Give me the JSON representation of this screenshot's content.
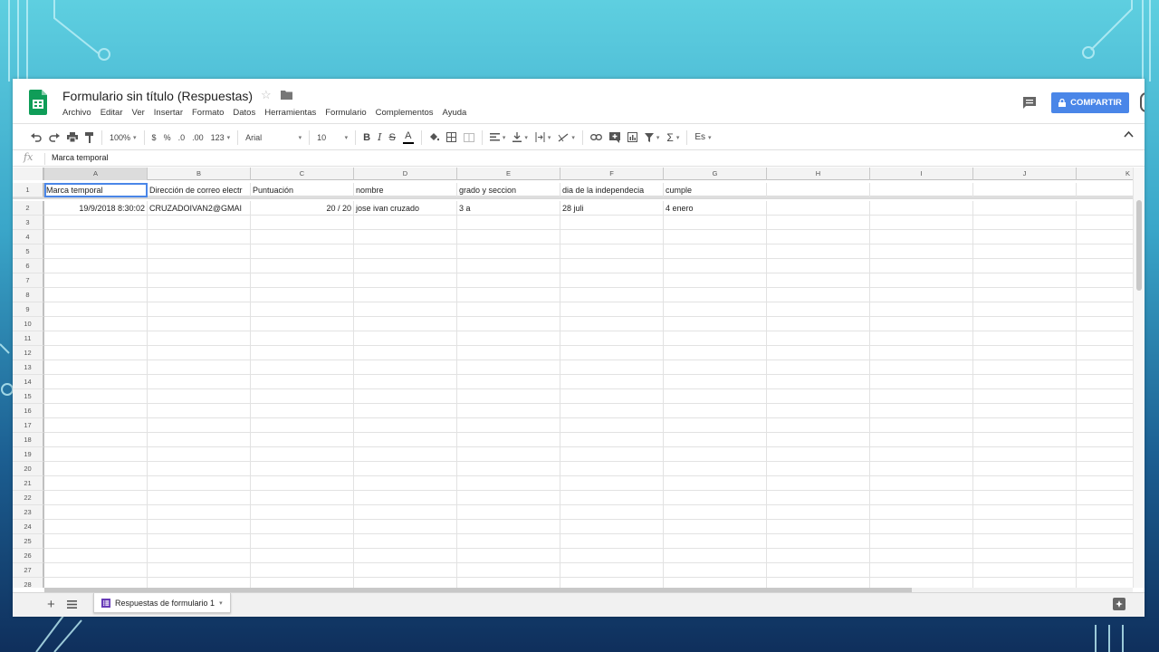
{
  "document": {
    "title": "Formulario sin título (Respuestas)"
  },
  "menu": [
    "Archivo",
    "Editar",
    "Ver",
    "Insertar",
    "Formato",
    "Datos",
    "Herramientas",
    "Formulario",
    "Complementos",
    "Ayuda"
  ],
  "share_button": {
    "label": "COMPARTIR",
    "color": "#4a86e8"
  },
  "toolbar": {
    "zoom": "100%",
    "currency": "$",
    "percent": "%",
    "decrease_decimals": ".0",
    "increase_decimals": ".00",
    "more_formats": "123",
    "font": "Arial",
    "font_size": "10",
    "bold": "B",
    "italic": "I",
    "text_color": "A",
    "functions": "Σ",
    "input_tools": "Es"
  },
  "formula_bar": {
    "fx_label": "fx",
    "value": "Marca temporal"
  },
  "grid": {
    "column_letters": [
      "A",
      "B",
      "C",
      "D",
      "E",
      "F",
      "G",
      "H",
      "I",
      "J",
      "K"
    ],
    "row_numbers": [
      "1",
      "2",
      "3",
      "4",
      "5",
      "6",
      "7",
      "8",
      "9",
      "10",
      "11",
      "12",
      "13",
      "14",
      "15",
      "16",
      "17",
      "18",
      "19",
      "20",
      "21",
      "22",
      "23",
      "24",
      "25",
      "26",
      "27",
      "28"
    ],
    "header_row": [
      "Marca temporal",
      "Dirección de correo electr",
      "Puntuación",
      "nombre",
      "grado y seccion",
      "dia de la independecia",
      "cumple"
    ],
    "data_row": [
      "19/9/2018 8:30:02",
      "CRUZADOIVAN2@GMAI",
      "20 / 20",
      "jose ivan cruzado",
      "3 a",
      "28 juli",
      "4 enero"
    ],
    "selected_cell": "A1"
  },
  "sheet_tab": {
    "label": "Respuestas de formulario 1"
  },
  "colors": {
    "sheets_green": "#0f9d58",
    "selection_blue": "#4a86e8",
    "form_purple": "#673ab7"
  }
}
